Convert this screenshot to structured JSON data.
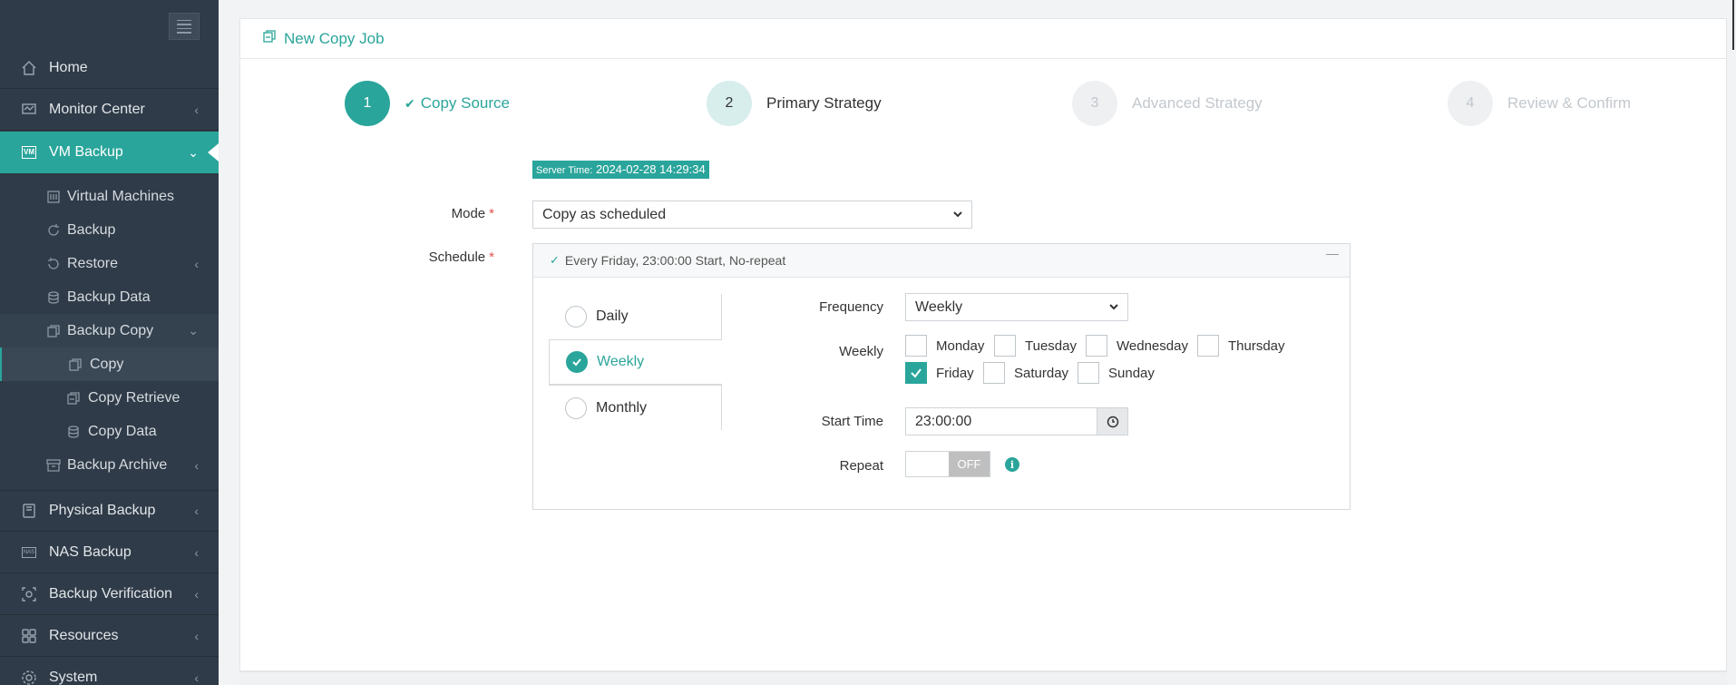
{
  "sidebar": {
    "items": [
      {
        "label": "Home",
        "icon": "home-icon"
      },
      {
        "label": "Monitor Center",
        "icon": "monitor-icon"
      },
      {
        "label": "VM Backup",
        "icon": "vm-icon",
        "icon_text": "VM"
      },
      {
        "label": "Virtual Machines",
        "icon": "server-icon"
      },
      {
        "label": "Backup",
        "icon": "backup-icon"
      },
      {
        "label": "Restore",
        "icon": "restore-icon"
      },
      {
        "label": "Backup Data",
        "icon": "database-icon"
      },
      {
        "label": "Backup Copy",
        "icon": "copy-icon"
      },
      {
        "label": "Copy",
        "icon": "copy-icon"
      },
      {
        "label": "Copy Retrieve",
        "icon": "copy-retrieve-icon"
      },
      {
        "label": "Copy Data",
        "icon": "database-icon"
      },
      {
        "label": "Backup Archive",
        "icon": "archive-icon"
      },
      {
        "label": "Physical Backup",
        "icon": "physical-icon"
      },
      {
        "label": "NAS Backup",
        "icon": "nas-icon",
        "icon_text": "NAS"
      },
      {
        "label": "Backup Verification",
        "icon": "verification-icon"
      },
      {
        "label": "Resources",
        "icon": "resources-icon"
      },
      {
        "label": "System",
        "icon": "gear-icon"
      }
    ]
  },
  "header": {
    "title": "New Copy Job",
    "icon": "new-job-icon"
  },
  "steps": [
    {
      "num": "1",
      "label": "Copy Source",
      "state": "done"
    },
    {
      "num": "2",
      "label": "Primary Strategy",
      "state": "current"
    },
    {
      "num": "3",
      "label": "Advanced Strategy",
      "state": "todo"
    },
    {
      "num": "4",
      "label": "Review & Confirm",
      "state": "todo"
    }
  ],
  "server_time": {
    "prefix": "Server Time:",
    "value": "2024-02-28 14:29:34"
  },
  "form": {
    "mode_label": "Mode",
    "mode_value": "Copy as scheduled",
    "schedule_label": "Schedule",
    "required_mark": "*"
  },
  "schedule": {
    "summary": "Every Friday, 23:00:00 Start, No-repeat",
    "freq_tabs": [
      "Daily",
      "Weekly",
      "Monthly"
    ],
    "selected_tab": "Weekly",
    "frequency_label": "Frequency",
    "frequency_value": "Weekly",
    "weekly_label": "Weekly",
    "days": [
      {
        "label": "Monday",
        "checked": false
      },
      {
        "label": "Tuesday",
        "checked": false
      },
      {
        "label": "Wednesday",
        "checked": false
      },
      {
        "label": "Thursday",
        "checked": false
      },
      {
        "label": "Friday",
        "checked": true
      },
      {
        "label": "Saturday",
        "checked": false
      },
      {
        "label": "Sunday",
        "checked": false
      }
    ],
    "start_time_label": "Start Time",
    "start_time_value": "23:00:00",
    "repeat_label": "Repeat",
    "repeat_state": "OFF",
    "info_glyph": "i"
  },
  "colors": {
    "accent": "#2aa59b",
    "sidebar": "#2f3b48"
  }
}
